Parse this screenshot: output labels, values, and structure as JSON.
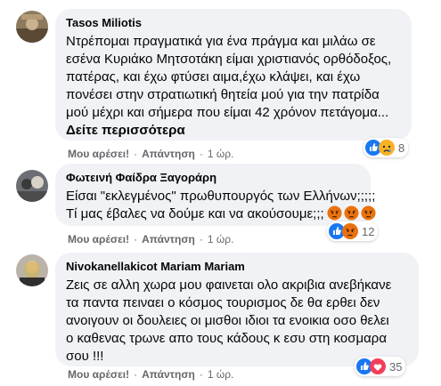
{
  "comments": [
    {
      "author": "Tasos Miliotis",
      "lines": [
        "Ντρέπομαι πραγματικά για ένα πράγμα και μιλάω σε",
        "εσένα Κυριάκο Μητσοτάκη είμαι χριστιανός ορθόδοξος,",
        "πατέρας, και έχω φτύσει αιμα,έχω κλάψει, και έχω",
        "πονέσει στην στρατιωτική θητεία μού για την πατρίδα",
        "μού μέχρι και σήμερα που είμαι 42 χρόνον πετάγομα..."
      ],
      "see_more": "Δείτε περισσότερα",
      "like": "Μου αρέσει!",
      "reply": "Απάντηση",
      "time": "1 ώρ.",
      "reactions": [
        "like-icon",
        "sad-icon"
      ],
      "reaction_count": "8"
    },
    {
      "author": "Φωτεινή Φαίδρα Ξαγοράρη",
      "lines": [
        "Είσαι \"εκλεγμένος\" πρωθυπουργός των Ελλήνων;;;;;",
        "Τί μας έβαλες να δούμε και να ακούσουμε;;;"
      ],
      "like": "Μου αρέσει!",
      "reply": "Απάντηση",
      "time": "1 ώρ.",
      "reactions": [
        "like-icon",
        "angry-icon"
      ],
      "reaction_count": "12"
    },
    {
      "author": "Nivokanellakicot Mariam Mariam",
      "lines": [
        "Ζεις σε αλλη χωρα μου φαινεται ολο ακριβια ανεβήκανε",
        "τα παντα πειναει ο κόσμος τουρισμος δε θα ερθει δεν",
        "ανοιγουν οι δουλειες οι μισθοι ιδιοι τα ενοικια οσο θελει",
        "ο καθενας τρωνε απο τους κάδους κ εσυ στη κοσμαρα",
        "σου !!!"
      ],
      "like": "Μου αρέσει!",
      "reply": "Απάντηση",
      "time": "1 ώρ.",
      "reactions": [
        "like-icon",
        "love-icon"
      ],
      "reaction_count": "35"
    }
  ],
  "colors": {
    "bubble": "#f0f2f5",
    "meta": "#65676b",
    "like": "#1877f2",
    "love": "#f33e58",
    "angry": "#e9710f",
    "sad": "#f7b125"
  }
}
